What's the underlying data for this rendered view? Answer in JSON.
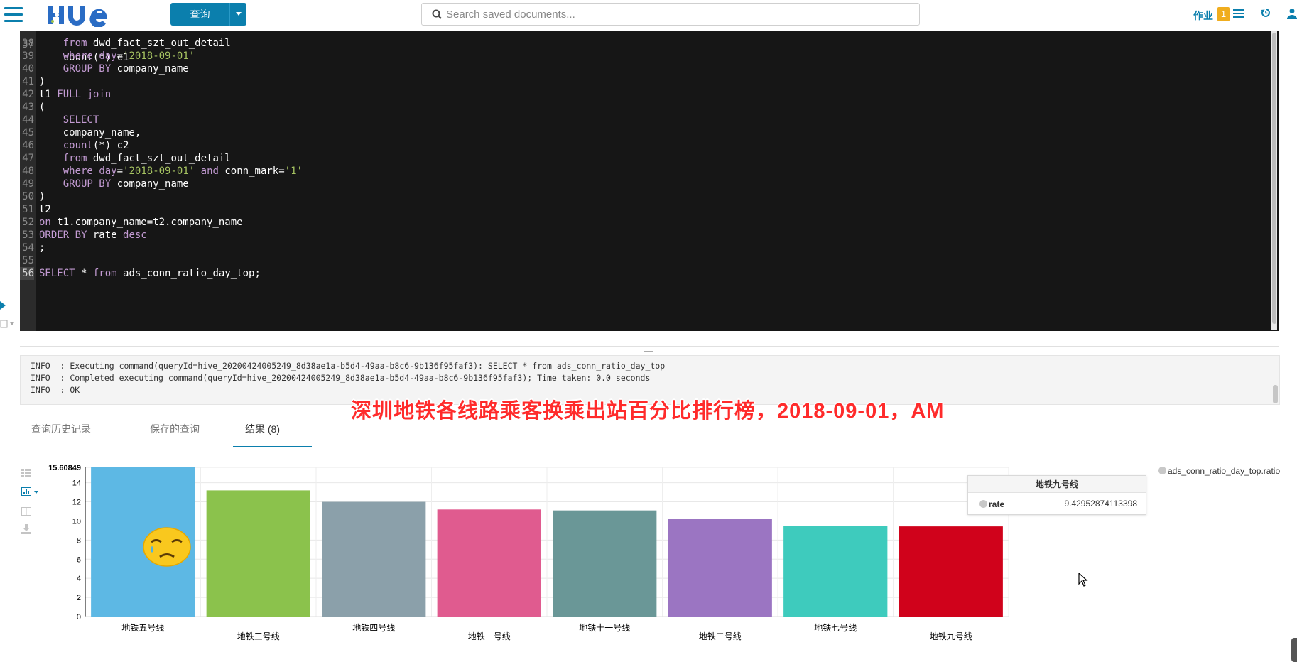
{
  "navbar": {
    "brand": "HUE",
    "query_button": "查询",
    "search_placeholder": "Search saved documents...",
    "jobs_label": "作业",
    "jobs_count": "1"
  },
  "editor": {
    "lines": [
      {
        "n": "38",
        "segs": [
          [
            "    ",
            ""
          ],
          [
            "from",
            "kw"
          ],
          [
            " dwd_fact_szt_out_detail",
            ""
          ]
        ]
      },
      {
        "n": "39",
        "segs": [
          [
            "    ",
            ""
          ],
          [
            "where",
            "kw"
          ],
          [
            " ",
            ""
          ],
          [
            "day",
            "kw"
          ],
          [
            "=",
            ""
          ],
          [
            "'2018-09-01'",
            "str"
          ]
        ]
      },
      {
        "n": "40",
        "segs": [
          [
            "    ",
            ""
          ],
          [
            "GROUP BY",
            "kw"
          ],
          [
            " company_name",
            ""
          ]
        ]
      },
      {
        "n": "41",
        "segs": [
          [
            ")",
            ""
          ]
        ]
      },
      {
        "n": "42",
        "segs": [
          [
            "t1 ",
            ""
          ],
          [
            "FULL join",
            "kw"
          ]
        ]
      },
      {
        "n": "43",
        "segs": [
          [
            "(",
            ""
          ]
        ]
      },
      {
        "n": "44",
        "segs": [
          [
            "    ",
            ""
          ],
          [
            "SELECT",
            "kw"
          ]
        ]
      },
      {
        "n": "45",
        "segs": [
          [
            "    company_name,",
            ""
          ]
        ]
      },
      {
        "n": "46",
        "segs": [
          [
            "    ",
            ""
          ],
          [
            "count",
            "kw"
          ],
          [
            "(*) c2",
            ""
          ]
        ]
      },
      {
        "n": "47",
        "segs": [
          [
            "    ",
            ""
          ],
          [
            "from",
            "kw"
          ],
          [
            " dwd_fact_szt_out_detail",
            ""
          ]
        ]
      },
      {
        "n": "48",
        "segs": [
          [
            "    ",
            ""
          ],
          [
            "where",
            "kw"
          ],
          [
            " ",
            ""
          ],
          [
            "day",
            "kw"
          ],
          [
            "=",
            ""
          ],
          [
            "'2018-09-01'",
            "str"
          ],
          [
            " ",
            ""
          ],
          [
            "and",
            "kw"
          ],
          [
            " conn_mark=",
            ""
          ],
          [
            "'1'",
            "str"
          ]
        ]
      },
      {
        "n": "49",
        "segs": [
          [
            "    ",
            ""
          ],
          [
            "GROUP BY",
            "kw"
          ],
          [
            " company_name",
            ""
          ]
        ]
      },
      {
        "n": "50",
        "segs": [
          [
            ")",
            ""
          ]
        ]
      },
      {
        "n": "51",
        "segs": [
          [
            "t2",
            ""
          ]
        ]
      },
      {
        "n": "52",
        "segs": [
          [
            "on",
            "kw"
          ],
          [
            " t1.company_name=t2.company_name",
            ""
          ]
        ]
      },
      {
        "n": "53",
        "segs": [
          [
            "ORDER BY",
            "kw"
          ],
          [
            " rate ",
            ""
          ],
          [
            "desc",
            "kw"
          ]
        ]
      },
      {
        "n": "54",
        "segs": [
          [
            ";",
            ""
          ]
        ]
      },
      {
        "n": "55",
        "segs": []
      },
      {
        "n": "56",
        "segs": [
          [
            "SELECT",
            "kw"
          ],
          [
            " * ",
            ""
          ],
          [
            "from",
            "kw"
          ],
          [
            " ads_conn_ratio_day_top;",
            ""
          ]
        ],
        "active": true
      }
    ],
    "partial_top_line": "    count(*) c1"
  },
  "log": {
    "lines": [
      "INFO  : Executing command(queryId=hive_20200424005249_8d38ae1a-b5d4-49aa-b8c6-9b136f95faf3): SELECT * from ads_conn_ratio_day_top",
      "INFO  : Completed executing command(queryId=hive_20200424005249_8d38ae1a-b5d4-49aa-b8c6-9b136f95faf3); Time taken: 0.0 seconds",
      "INFO  : OK"
    ]
  },
  "overlay_caption": "深圳地铁各线路乘客换乘出站百分比排行榜，2018-09-01，AM",
  "tabs": [
    {
      "label": "查询历史记录",
      "active": false
    },
    {
      "label": "保存的查询",
      "active": false
    },
    {
      "label": "结果 (8)",
      "active": true
    }
  ],
  "chart_data": {
    "type": "bar",
    "categories": [
      "地铁五号线",
      "地铁三号线",
      "地铁四号线",
      "地铁一号线",
      "地铁十一号线",
      "地铁二号线",
      "地铁七号线",
      "地铁九号线"
    ],
    "values": [
      15.60849,
      13.2,
      12.0,
      11.2,
      11.1,
      10.2,
      9.5,
      9.42952874113398
    ],
    "colors": [
      "#5db8e4",
      "#8bc24c",
      "#8ba0aa",
      "#e05b8f",
      "#6a9797",
      "#9b75c2",
      "#3ecbbd",
      "#d0021b"
    ],
    "ylim": [
      0,
      15.60849
    ],
    "yticks": [
      "0",
      "2",
      "4",
      "6",
      "8",
      "10",
      "12",
      "14",
      "15.60849"
    ],
    "grid": true,
    "legend": {
      "position": "top-right",
      "series_name": "ads_conn_ratio_day_top.ratio"
    },
    "tooltip": {
      "title": "地铁九号线",
      "series": "rate",
      "value": "9.42952874113398"
    }
  }
}
